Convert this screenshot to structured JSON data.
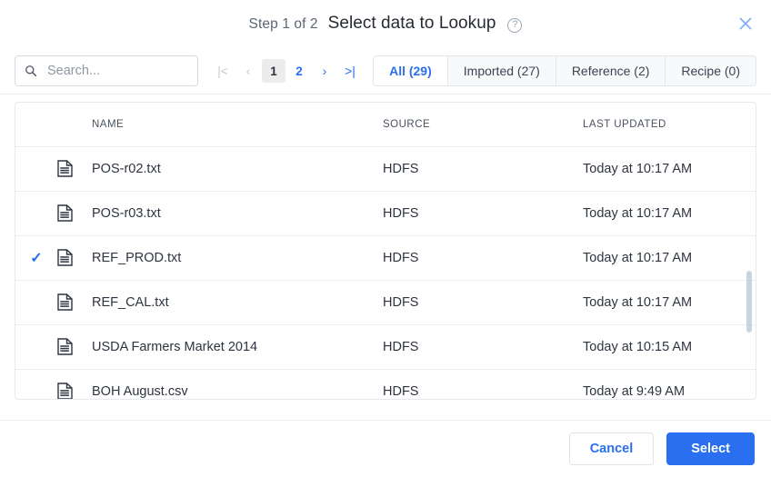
{
  "header": {
    "step_label": "Step 1 of 2",
    "title": "Select data to Lookup",
    "help_icon": "help-circle-icon",
    "close_icon": "close-icon"
  },
  "toolbar": {
    "search": {
      "icon": "search-icon",
      "placeholder": "Search...",
      "value": ""
    },
    "pagination": {
      "first_label": "|<",
      "prev_label": "‹",
      "next_label": "›",
      "last_label": ">|",
      "pages": [
        "1",
        "2"
      ],
      "active_page": "1"
    },
    "tabs": [
      {
        "label": "All (29)",
        "active": true
      },
      {
        "label": "Imported (27)",
        "active": false
      },
      {
        "label": "Reference (2)",
        "active": false
      },
      {
        "label": "Recipe (0)",
        "active": false
      }
    ]
  },
  "table": {
    "columns": [
      "NAME",
      "SOURCE",
      "LAST UPDATED"
    ],
    "rows": [
      {
        "selected": false,
        "icon": "file-document-icon",
        "name": "POS-r02.txt",
        "source": "HDFS",
        "updated": "Today at 10:17 AM"
      },
      {
        "selected": false,
        "icon": "file-document-icon",
        "name": "POS-r03.txt",
        "source": "HDFS",
        "updated": "Today at 10:17 AM"
      },
      {
        "selected": true,
        "icon": "file-document-icon",
        "name": "REF_PROD.txt",
        "source": "HDFS",
        "updated": "Today at 10:17 AM"
      },
      {
        "selected": false,
        "icon": "file-document-icon",
        "name": "REF_CAL.txt",
        "source": "HDFS",
        "updated": "Today at 10:17 AM"
      },
      {
        "selected": false,
        "icon": "file-document-icon",
        "name": "USDA Farmers Market 2014",
        "source": "HDFS",
        "updated": "Today at 10:15 AM"
      },
      {
        "selected": false,
        "icon": "file-document-icon",
        "name": "BOH August.csv",
        "source": "HDFS",
        "updated": "Today at 9:49 AM"
      }
    ],
    "check_glyph": "✓"
  },
  "footer": {
    "cancel_label": "Cancel",
    "select_label": "Select"
  },
  "colors": {
    "accent": "#2a6ff0",
    "text": "#2e3440",
    "muted": "#5a6573",
    "border": "#e6eaf0",
    "tab_bg": "#f7f9fb",
    "scrollbar": "#c9d4e2"
  }
}
